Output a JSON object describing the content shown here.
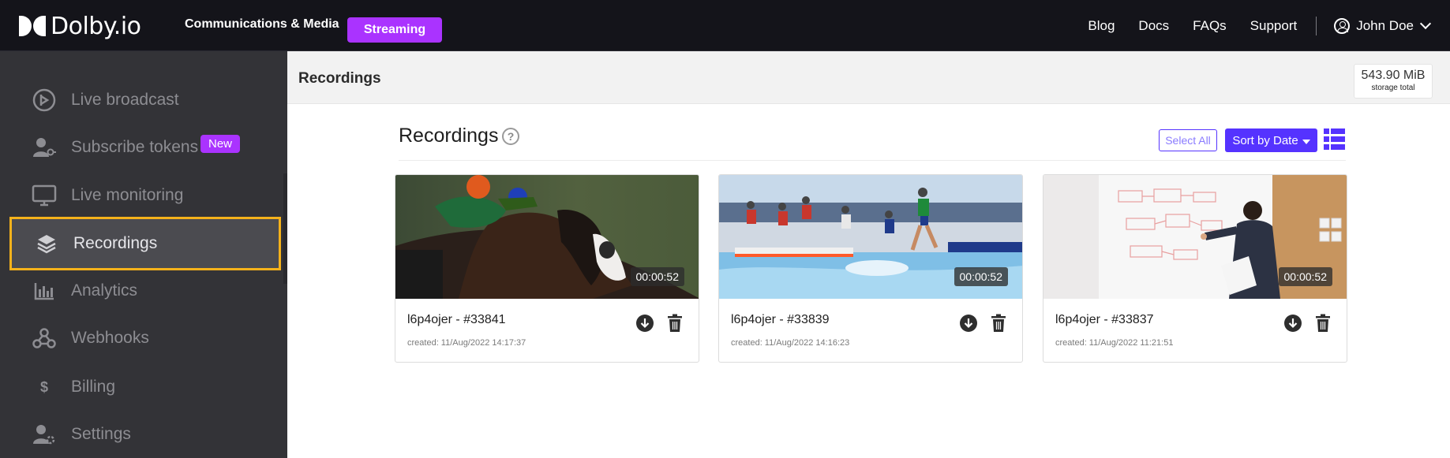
{
  "brand": {
    "logo_text": "Dolby.io"
  },
  "topnav": {
    "communications": "Communications & Media",
    "streaming": "Streaming",
    "links": [
      "Blog",
      "Docs",
      "FAQs",
      "Support"
    ],
    "user_name": "John Doe"
  },
  "sidebar": {
    "items": [
      {
        "label": "Live broadcast",
        "icon": "broadcast-icon"
      },
      {
        "label": "Subscribe tokens",
        "icon": "user-key-icon"
      },
      {
        "label": "Live monitoring",
        "icon": "monitor-icon",
        "badge": "New"
      },
      {
        "label": "Recordings",
        "icon": "layers-icon",
        "active": true
      },
      {
        "label": "Analytics",
        "icon": "bar-chart-icon"
      },
      {
        "label": "Webhooks",
        "icon": "webhook-icon"
      },
      {
        "label": "Billing",
        "icon": "dollar-icon"
      },
      {
        "label": "Settings",
        "icon": "user-gear-icon"
      }
    ]
  },
  "subheader": {
    "title": "Recordings",
    "storage_value": "543.90 MiB",
    "storage_label": "storage total"
  },
  "main": {
    "title": "Recordings",
    "help": "?",
    "select_all": "Select All",
    "sort_label": "Sort by Date",
    "recordings": [
      {
        "name": "l6p4ojer - #33841",
        "created": "created: 11/Aug/2022 14:17:37",
        "duration": "00:00:52",
        "thumbnail": "horse-racing"
      },
      {
        "name": "l6p4ojer - #33839",
        "created": "created: 11/Aug/2022 14:16:23",
        "duration": "00:00:52",
        "thumbnail": "steeplechase-running"
      },
      {
        "name": "l6p4ojer - #33837",
        "created": "created: 11/Aug/2022 11:21:51",
        "duration": "00:00:52",
        "thumbnail": "whiteboard-presenter"
      }
    ]
  },
  "colors": {
    "accent_purple": "#aa33ff",
    "primary_blue": "#5533ff",
    "active_outline": "#f5b21b",
    "sidebar_bg": "#333337",
    "topnav_bg": "#14141a"
  }
}
